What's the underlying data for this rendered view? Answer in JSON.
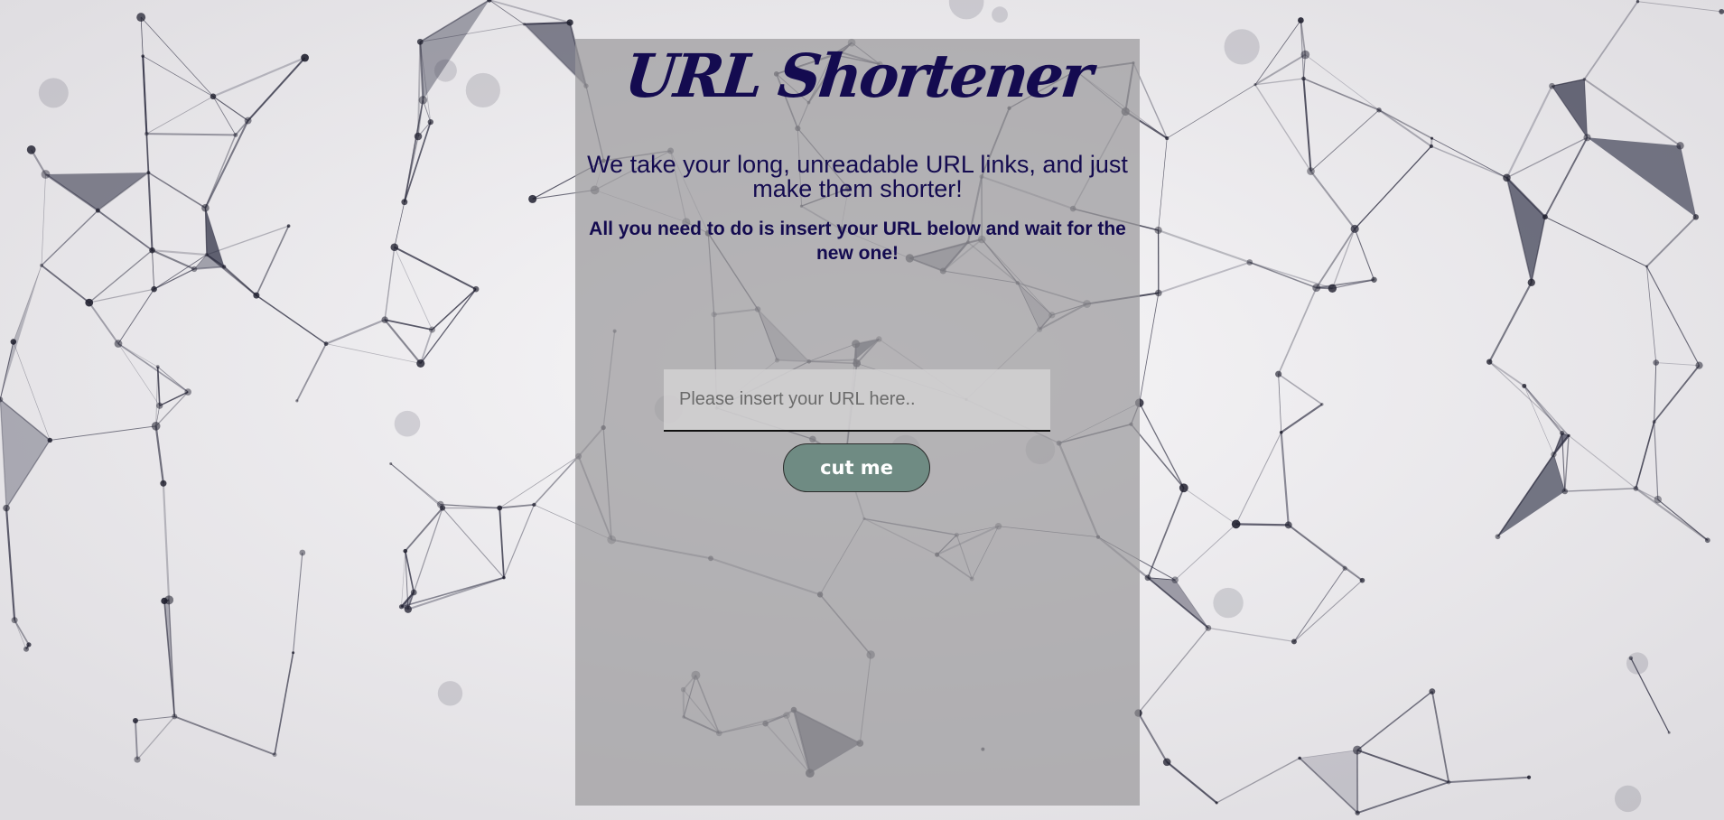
{
  "app": {
    "title": "URL Shortener",
    "headline": "We take your long, unreadable URL links, and just make them shorter!",
    "instructions": "All you need to do is insert your URL below and wait for the new one!"
  },
  "form": {
    "url_value": "",
    "url_placeholder": "Please insert your URL here..",
    "submit_label": "cut me"
  },
  "colors": {
    "title_text": "#140b50",
    "button_bg": "#6f8b83",
    "panel_overlay": "#9b9a9c"
  }
}
